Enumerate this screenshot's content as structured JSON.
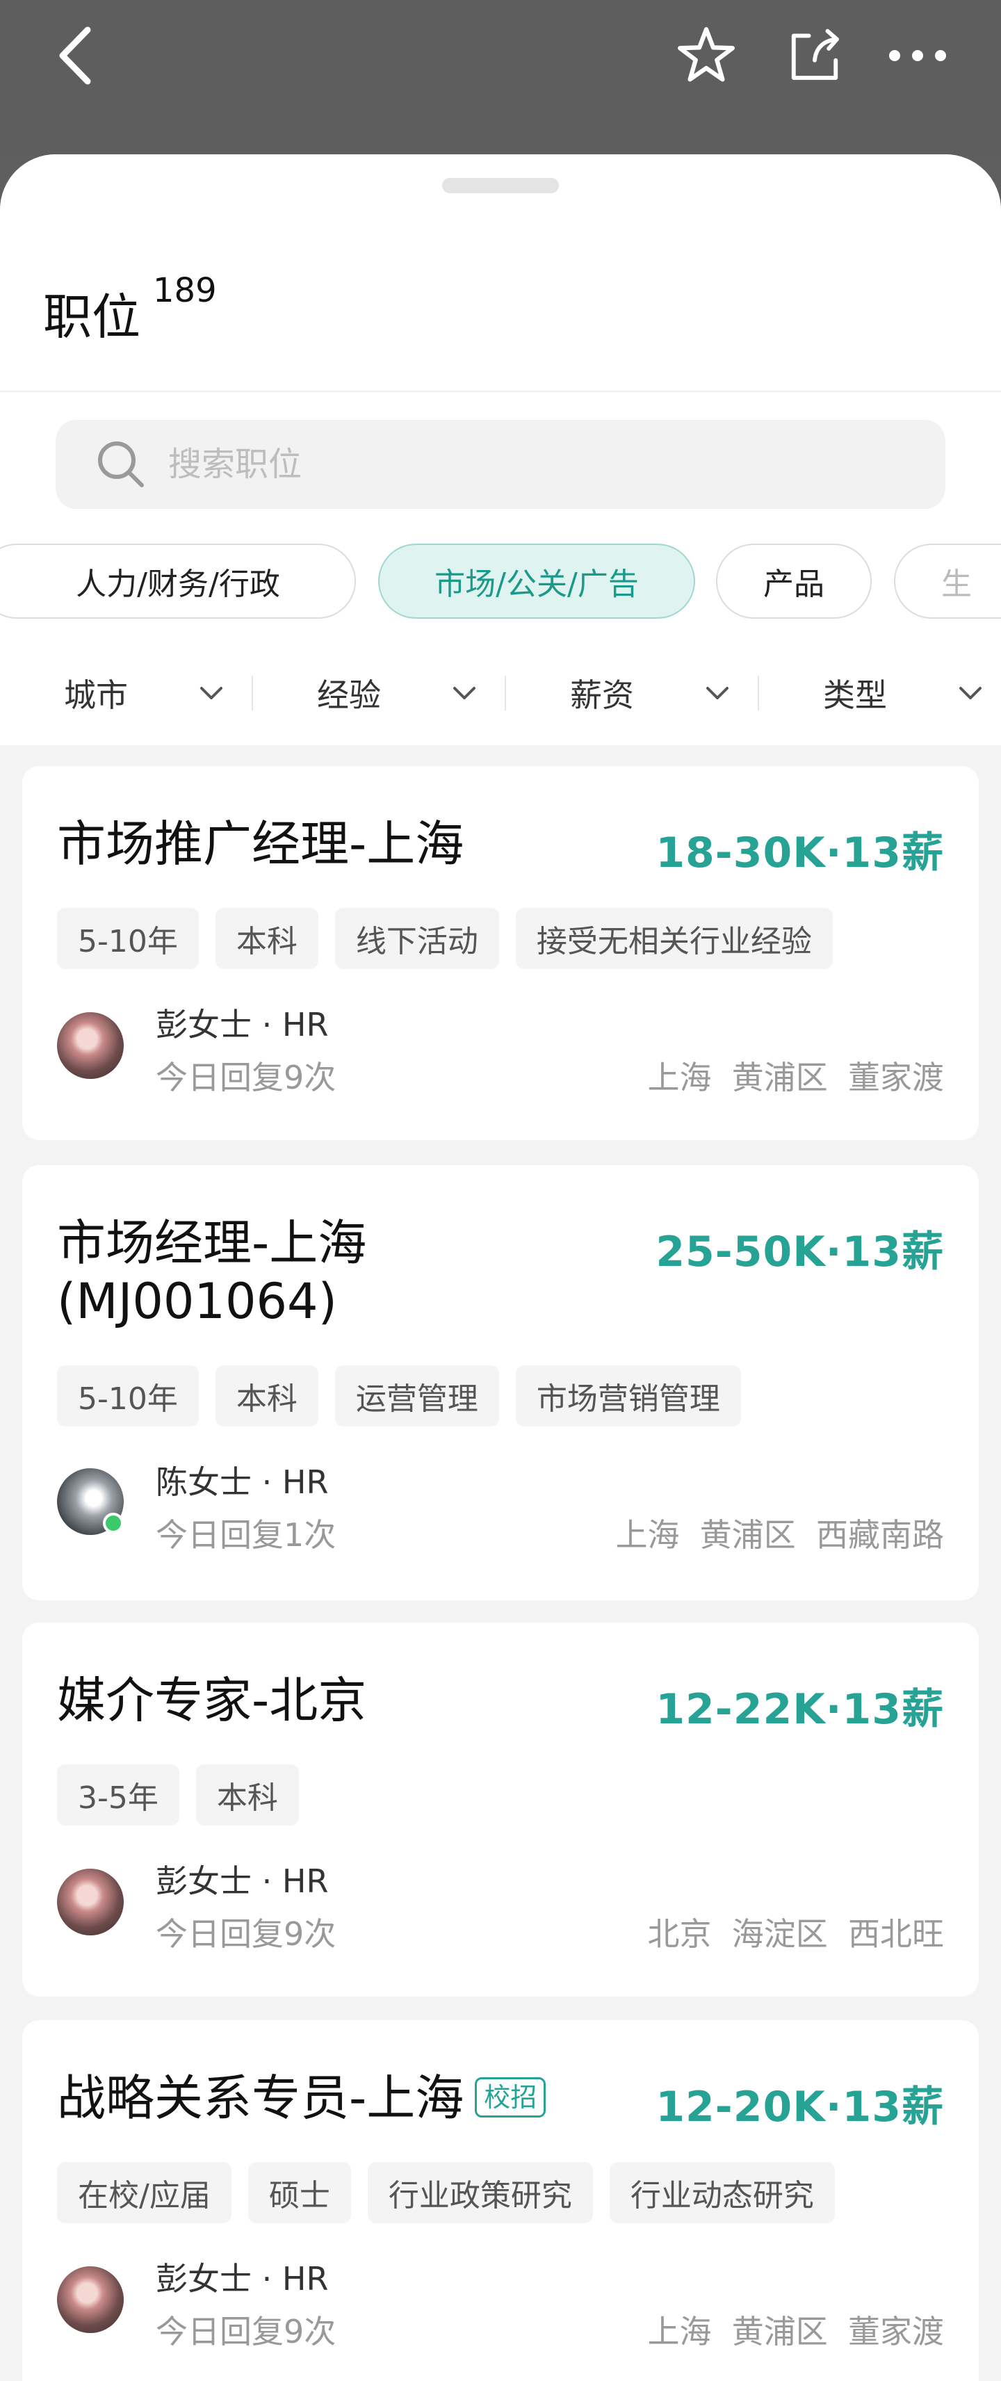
{
  "nav": {
    "back_icon": "chevron-left-icon",
    "favorite_icon": "star-icon",
    "share_icon": "share-icon",
    "more_icon": "more-icon"
  },
  "header": {
    "title": "职位",
    "count": "189"
  },
  "search": {
    "placeholder": "搜索职位"
  },
  "categories": [
    {
      "label": "人力/财务/行政",
      "active": false
    },
    {
      "label": "市场/公关/广告",
      "active": true
    },
    {
      "label": "产品",
      "active": false
    },
    {
      "label": "生",
      "active": false
    }
  ],
  "filters": [
    "城市",
    "经验",
    "薪资",
    "类型"
  ],
  "jobs": [
    {
      "title": "市场推广经理-上海",
      "salary": "18-30K·13薪",
      "tags": [
        "5-10年",
        "本科",
        "线下活动",
        "接受无相关行业经验"
      ],
      "recruiter": "彭女士 · HR",
      "reply": "今日回复9次",
      "location": "上海  黄浦区  董家渡"
    },
    {
      "title_line1": "市场经理-上海",
      "title_line2": "(MJ001064)",
      "salary": "25-50K·13薪",
      "tags": [
        "5-10年",
        "本科",
        "运营管理",
        "市场营销管理"
      ],
      "recruiter": "陈女士 · HR",
      "reply": "今日回复1次",
      "location": "上海  黄浦区  西藏南路"
    },
    {
      "title": "媒介专家-北京",
      "salary": "12-22K·13薪",
      "tags": [
        "3-5年",
        "本科"
      ],
      "recruiter": "彭女士 · HR",
      "reply": "今日回复9次",
      "location": "北京  海淀区  西北旺"
    },
    {
      "title": "战略关系专员-上海",
      "badge": "校招",
      "salary": "12-20K·13薪",
      "tags": [
        "在校/应届",
        "硕士",
        "行业政策研究",
        "行业动态研究"
      ],
      "recruiter": "彭女士 · HR",
      "reply": "今日回复9次",
      "location": "上海  黄浦区  董家渡"
    }
  ],
  "colors": {
    "accent": "#27a396",
    "chip_active_bg": "#dff3f0",
    "online": "#3cc96a"
  }
}
